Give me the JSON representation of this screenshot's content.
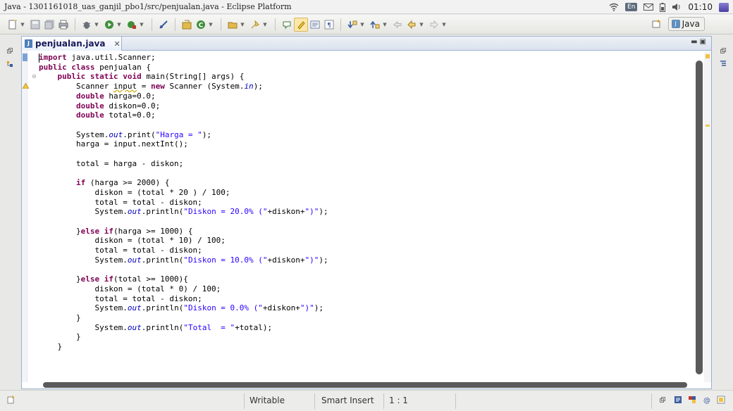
{
  "window": {
    "title": "Java - 1301161018_uas_ganjil_pbo1/src/penjualan.java - Eclipse Platform"
  },
  "system_tray": {
    "keyboard_layout": "En",
    "time": "01:10",
    "icons": [
      "wifi-icon",
      "mail-icon",
      "battery-icon",
      "volume-icon",
      "user-icon"
    ]
  },
  "toolbar": {
    "icons": [
      "new-icon",
      "save-icon",
      "save-all-icon",
      "print-icon",
      "debug-icon",
      "run-icon",
      "run-external-icon",
      "toggle-breakpoint-icon",
      "new-java-project-icon",
      "new-class-icon",
      "open-type-icon",
      "search-icon",
      "mark-occurrences-icon",
      "highlight-icon",
      "show-whitespace-icon",
      "paragraph-icon",
      "next-annotation-icon",
      "previous-annotation-icon",
      "back-icon",
      "forward-icon"
    ],
    "perspective_label": "Java"
  },
  "editor": {
    "tab_label": "penjualan.java",
    "code_lines": [
      [
        [
          "kw",
          "import"
        ],
        [
          "t",
          " java.util.Scanner;"
        ]
      ],
      [
        [
          "kw",
          "public class"
        ],
        [
          "t",
          " penjualan {"
        ]
      ],
      [
        [
          "t",
          "    "
        ],
        [
          "kw",
          "public static void"
        ],
        [
          "t",
          " main(String[] args) {"
        ]
      ],
      [
        [
          "t",
          "        Scanner "
        ],
        [
          "warn",
          "input"
        ],
        [
          "t",
          " = "
        ],
        [
          "kw",
          "new"
        ],
        [
          "t",
          " Scanner (System."
        ],
        [
          "fld",
          "in"
        ],
        [
          "t",
          ");"
        ]
      ],
      [
        [
          "t",
          "        "
        ],
        [
          "kw",
          "double"
        ],
        [
          "t",
          " harga=0.0;"
        ]
      ],
      [
        [
          "t",
          "        "
        ],
        [
          "kw",
          "double"
        ],
        [
          "t",
          " diskon=0.0;"
        ]
      ],
      [
        [
          "t",
          "        "
        ],
        [
          "kw",
          "double"
        ],
        [
          "t",
          " total=0.0;"
        ]
      ],
      [
        [
          "t",
          ""
        ]
      ],
      [
        [
          "t",
          "        System."
        ],
        [
          "fld",
          "out"
        ],
        [
          "t",
          ".print("
        ],
        [
          "str",
          "\"Harga = \""
        ],
        [
          "t",
          ");"
        ]
      ],
      [
        [
          "t",
          "        harga = input.nextInt();"
        ]
      ],
      [
        [
          "t",
          ""
        ]
      ],
      [
        [
          "t",
          "        total = harga - diskon;"
        ]
      ],
      [
        [
          "t",
          ""
        ]
      ],
      [
        [
          "t",
          "        "
        ],
        [
          "kw",
          "if"
        ],
        [
          "t",
          " (harga >= 2000) {"
        ]
      ],
      [
        [
          "t",
          "            diskon = (total * 20 ) / 100;"
        ]
      ],
      [
        [
          "t",
          "            total = total - diskon;"
        ]
      ],
      [
        [
          "t",
          "            System."
        ],
        [
          "fld",
          "out"
        ],
        [
          "t",
          ".println("
        ],
        [
          "str",
          "\"Diskon = 20.0% (\""
        ],
        [
          "t",
          "+diskon+"
        ],
        [
          "str",
          "\")\""
        ],
        [
          "t",
          ");"
        ]
      ],
      [
        [
          "t",
          ""
        ]
      ],
      [
        [
          "t",
          "        }"
        ],
        [
          "kw",
          "else if"
        ],
        [
          "t",
          "(harga >= 1000) {"
        ]
      ],
      [
        [
          "t",
          "            diskon = (total * 10) / 100;"
        ]
      ],
      [
        [
          "t",
          "            total = total - diskon;"
        ]
      ],
      [
        [
          "t",
          "            System."
        ],
        [
          "fld",
          "out"
        ],
        [
          "t",
          ".println("
        ],
        [
          "str",
          "\"Diskon = 10.0% (\""
        ],
        [
          "t",
          "+diskon+"
        ],
        [
          "str",
          "\")\""
        ],
        [
          "t",
          ");"
        ]
      ],
      [
        [
          "t",
          ""
        ]
      ],
      [
        [
          "t",
          "        }"
        ],
        [
          "kw",
          "else if"
        ],
        [
          "t",
          "(total >= 1000){"
        ]
      ],
      [
        [
          "t",
          "            diskon = (total * 0) / 100;"
        ]
      ],
      [
        [
          "t",
          "            total = total - diskon;"
        ]
      ],
      [
        [
          "t",
          "            System."
        ],
        [
          "fld",
          "out"
        ],
        [
          "t",
          ".println("
        ],
        [
          "str",
          "\"Diskon = 0.0% (\""
        ],
        [
          "t",
          "+diskon+"
        ],
        [
          "str",
          "\")\""
        ],
        [
          "t",
          ");"
        ]
      ],
      [
        [
          "t",
          "        }"
        ]
      ],
      [
        [
          "t",
          "            System."
        ],
        [
          "fld",
          "out"
        ],
        [
          "t",
          ".println("
        ],
        [
          "str",
          "\"Total  = \""
        ],
        [
          "t",
          "+total);"
        ]
      ],
      [
        [
          "t",
          "        }"
        ]
      ],
      [
        [
          "t",
          "    }"
        ]
      ]
    ]
  },
  "status_bar": {
    "writable": "Writable",
    "insert_mode": "Smart Insert",
    "position": "1 : 1"
  }
}
